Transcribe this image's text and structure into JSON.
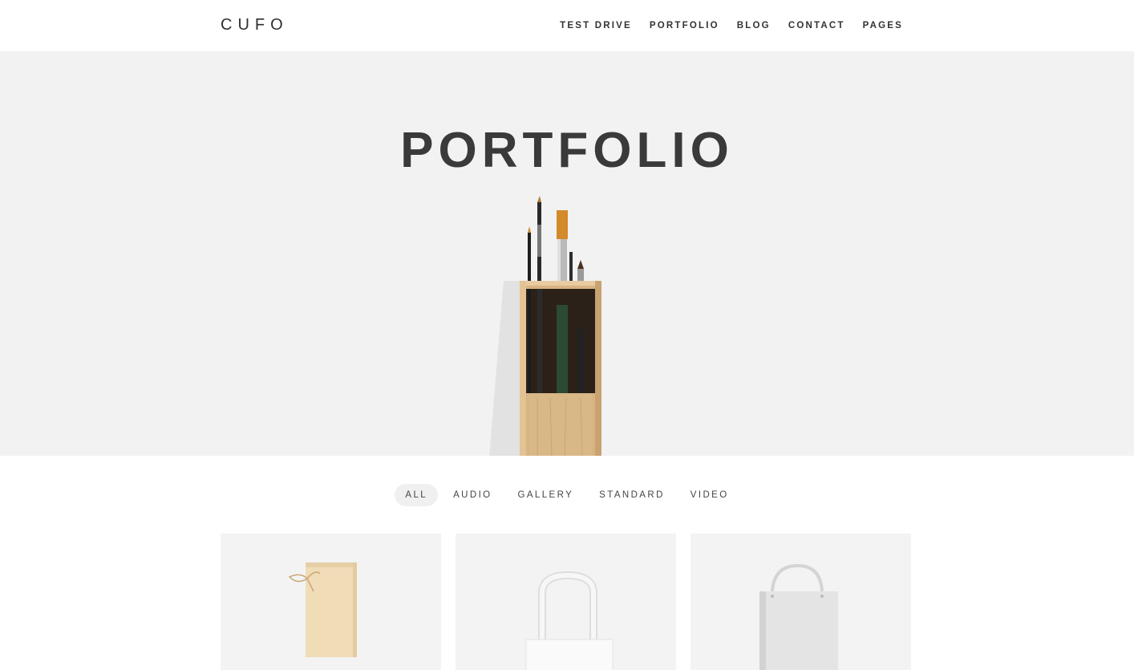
{
  "brand": {
    "logo": "CUFO"
  },
  "nav": {
    "items": [
      {
        "label": "TEST DRIVE"
      },
      {
        "label": "PORTFOLIO"
      },
      {
        "label": "BLOG"
      },
      {
        "label": "CONTACT"
      },
      {
        "label": "PAGES"
      }
    ]
  },
  "hero": {
    "title": "PORTFOLIO",
    "background": "#f2f2f2",
    "image_subject": "paint-brushes-in-wooden-box"
  },
  "filters": {
    "active": "ALL",
    "items": [
      {
        "label": "ALL"
      },
      {
        "label": "AUDIO"
      },
      {
        "label": "GALLERY"
      },
      {
        "label": "STANDARD"
      },
      {
        "label": "VIDEO"
      }
    ]
  },
  "portfolio": {
    "items": [
      {
        "subject": "linen-drawstring-pouch"
      },
      {
        "subject": "white-tote-bag"
      },
      {
        "subject": "white-paper-shopping-bag"
      }
    ]
  },
  "colors": {
    "text": "#333333",
    "hero_bg": "#f2f2f2",
    "card_bg": "#f3f3f3",
    "active_filter_bg": "#f0f0f0"
  }
}
